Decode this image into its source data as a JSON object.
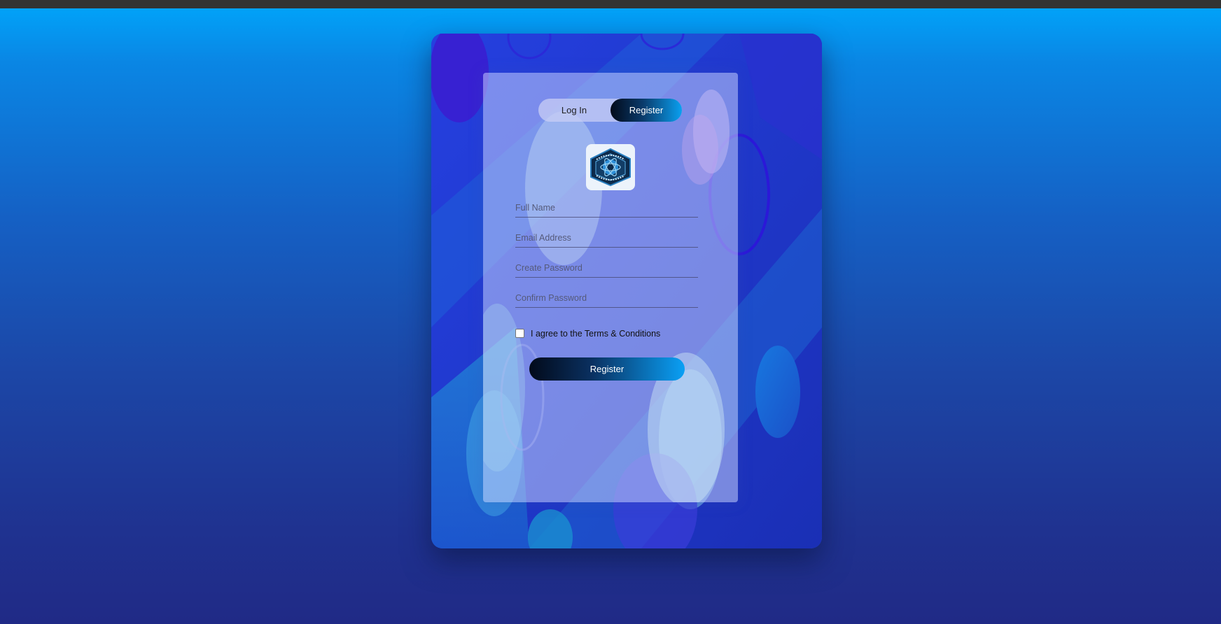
{
  "auth": {
    "tabs": [
      {
        "label": "Log In",
        "active": false
      },
      {
        "label": "Register",
        "active": true
      }
    ],
    "logo_icon": "hexagon-club-emblem",
    "fields": [
      {
        "placeholder": "Full Name",
        "value": ""
      },
      {
        "placeholder": "Email Address",
        "value": ""
      },
      {
        "placeholder": "Create Password",
        "value": ""
      },
      {
        "placeholder": "Confirm Password",
        "value": ""
      }
    ],
    "terms_label": "I agree to the Terms & Conditions",
    "terms_checked": false,
    "submit_label": "Register"
  },
  "colors": {
    "page_top": "#00a6fb",
    "page_bottom": "#202a86",
    "button_start": "#020a1a",
    "button_end": "#0aa0f5"
  }
}
